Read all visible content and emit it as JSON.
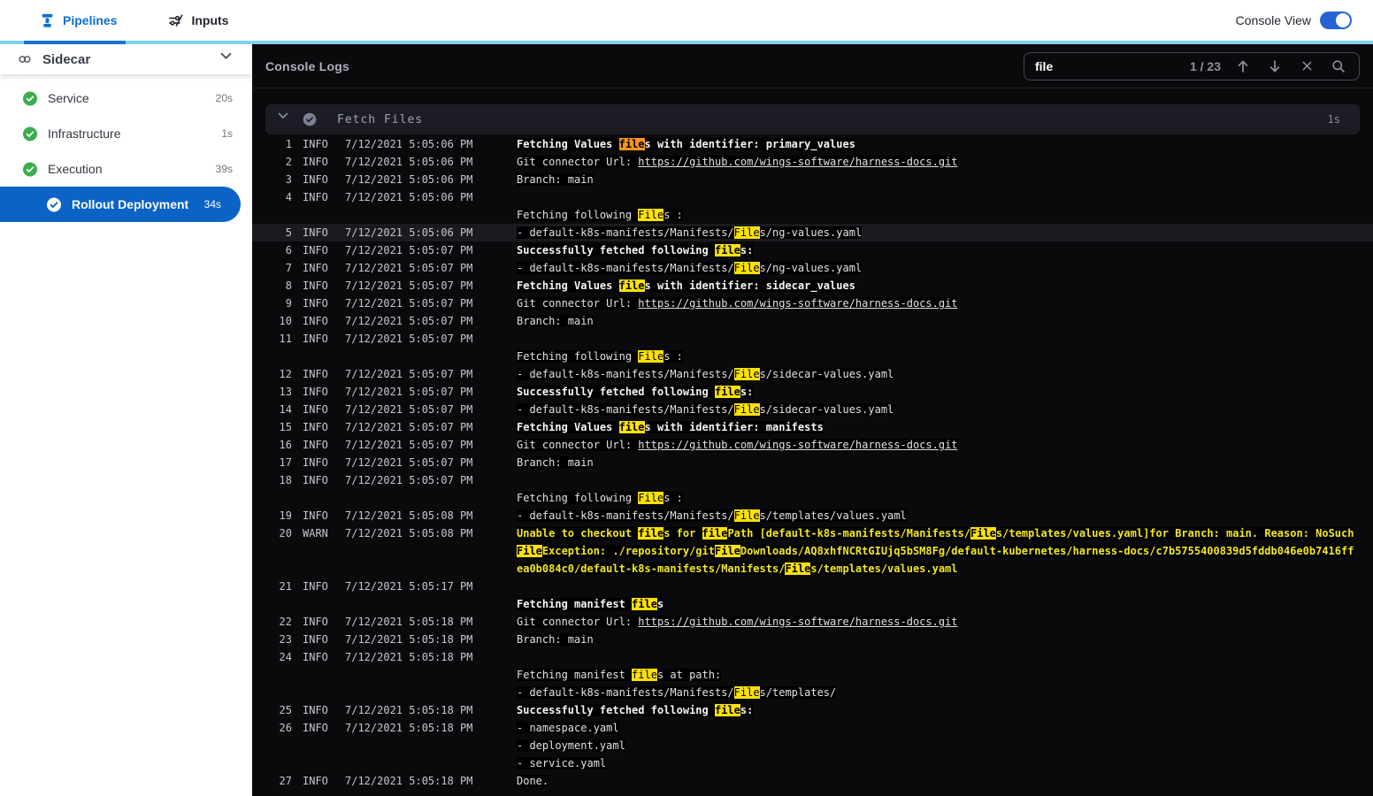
{
  "topbar": {
    "tabs": [
      {
        "label": "Pipelines"
      },
      {
        "label": "Inputs"
      }
    ],
    "active_tab": "Pipelines",
    "console_view_label": "Console View",
    "console_view_on": true
  },
  "sidebar": {
    "title": "Sidecar",
    "items": [
      {
        "label": "Service",
        "duration": "20s",
        "status": "success",
        "selected": false
      },
      {
        "label": "Infrastructure",
        "duration": "1s",
        "status": "success",
        "selected": false
      },
      {
        "label": "Execution",
        "duration": "39s",
        "status": "success",
        "selected": false
      },
      {
        "label": "Rollout Deployment",
        "duration": "34s",
        "status": "success",
        "selected": true
      }
    ]
  },
  "console": {
    "title": "Console Logs",
    "search": {
      "value": "file",
      "count_label": "1 / 23"
    },
    "section": {
      "title": "Fetch Files",
      "duration": "1s"
    }
  },
  "search_term": "file",
  "colors": {
    "accent_blue": "#0a70d3",
    "light_blue_bar": "#82d1f0",
    "selected_blue": "#0b63c5",
    "success_green": "#3bad4c",
    "match_current_bg": "#ff9321",
    "match_other_bg": "#fbe106",
    "warn_text": "#f4e81c"
  },
  "logs": [
    {
      "n": "1",
      "level": "INFO",
      "time": "7/12/2021 5:05:06 PM",
      "lines": [
        {
          "text": "Fetching Values files with identifier: primary_values",
          "bold": true
        }
      ]
    },
    {
      "n": "2",
      "level": "INFO",
      "time": "7/12/2021 5:05:06 PM",
      "lines": [
        {
          "text": "Git connector Url: ",
          "link": "https://github.com/wings-software/harness-docs.git"
        }
      ]
    },
    {
      "n": "3",
      "level": "INFO",
      "time": "7/12/2021 5:05:06 PM",
      "lines": [
        {
          "text": "Branch: main"
        }
      ]
    },
    {
      "n": "4",
      "level": "INFO",
      "time": "7/12/2021 5:05:06 PM",
      "lines": [
        {
          "text": ""
        },
        {
          "text": "Fetching following Files :"
        }
      ]
    },
    {
      "n": "5",
      "level": "INFO",
      "time": "7/12/2021 5:05:06 PM",
      "highlighted_row": true,
      "lines": [
        {
          "text": "- default-k8s-manifests/Manifests/Files/ng-values.yaml"
        }
      ]
    },
    {
      "n": "6",
      "level": "INFO",
      "time": "7/12/2021 5:05:07 PM",
      "lines": [
        {
          "text": "Successfully fetched following files:",
          "bold": true
        }
      ]
    },
    {
      "n": "7",
      "level": "INFO",
      "time": "7/12/2021 5:05:07 PM",
      "lines": [
        {
          "text": "- default-k8s-manifests/Manifests/Files/ng-values.yaml"
        }
      ]
    },
    {
      "n": "8",
      "level": "INFO",
      "time": "7/12/2021 5:05:07 PM",
      "lines": [
        {
          "text": "Fetching Values files with identifier: sidecar_values",
          "bold": true
        }
      ]
    },
    {
      "n": "9",
      "level": "INFO",
      "time": "7/12/2021 5:05:07 PM",
      "lines": [
        {
          "text": "Git connector Url: ",
          "link": "https://github.com/wings-software/harness-docs.git"
        }
      ]
    },
    {
      "n": "10",
      "level": "INFO",
      "time": "7/12/2021 5:05:07 PM",
      "lines": [
        {
          "text": "Branch: main"
        }
      ]
    },
    {
      "n": "11",
      "level": "INFO",
      "time": "7/12/2021 5:05:07 PM",
      "lines": [
        {
          "text": ""
        },
        {
          "text": "Fetching following Files :"
        }
      ]
    },
    {
      "n": "12",
      "level": "INFO",
      "time": "7/12/2021 5:05:07 PM",
      "lines": [
        {
          "text": "- default-k8s-manifests/Manifests/Files/sidecar-values.yaml"
        }
      ]
    },
    {
      "n": "13",
      "level": "INFO",
      "time": "7/12/2021 5:05:07 PM",
      "lines": [
        {
          "text": "Successfully fetched following files:",
          "bold": true
        }
      ]
    },
    {
      "n": "14",
      "level": "INFO",
      "time": "7/12/2021 5:05:07 PM",
      "lines": [
        {
          "text": "- default-k8s-manifests/Manifests/Files/sidecar-values.yaml"
        }
      ]
    },
    {
      "n": "15",
      "level": "INFO",
      "time": "7/12/2021 5:05:07 PM",
      "lines": [
        {
          "text": "Fetching Values files with identifier: manifests",
          "bold": true
        }
      ]
    },
    {
      "n": "16",
      "level": "INFO",
      "time": "7/12/2021 5:05:07 PM",
      "lines": [
        {
          "text": "Git connector Url: ",
          "link": "https://github.com/wings-software/harness-docs.git"
        }
      ]
    },
    {
      "n": "17",
      "level": "INFO",
      "time": "7/12/2021 5:05:07 PM",
      "lines": [
        {
          "text": "Branch: main"
        }
      ]
    },
    {
      "n": "18",
      "level": "INFO",
      "time": "7/12/2021 5:05:07 PM",
      "lines": [
        {
          "text": ""
        },
        {
          "text": "Fetching following Files :"
        }
      ]
    },
    {
      "n": "19",
      "level": "INFO",
      "time": "7/12/2021 5:05:08 PM",
      "lines": [
        {
          "text": "- default-k8s-manifests/Manifests/Files/templates/values.yaml"
        }
      ]
    },
    {
      "n": "20",
      "level": "WARN",
      "time": "7/12/2021 5:05:08 PM",
      "lines": [
        {
          "text": "Unable to checkout files for filePath [default-k8s-manifests/Manifests/Files/templates/values.yaml]for Branch: main. Reason: NoSuchFileException: ./repository/gitFileDownloads/AQ8xhfNCRtGIUjq5bSM8Fg/default-kubernetes/harness-docs/c7b5755400839d5fddb046e0b7416ffea0b084c0/default-k8s-manifests/Manifests/Files/templates/values.yaml",
          "bold": true
        }
      ]
    },
    {
      "n": "21",
      "level": "INFO",
      "time": "7/12/2021 5:05:17 PM",
      "lines": [
        {
          "text": ""
        },
        {
          "text": "Fetching manifest files",
          "bold": true
        }
      ]
    },
    {
      "n": "22",
      "level": "INFO",
      "time": "7/12/2021 5:05:18 PM",
      "lines": [
        {
          "text": "Git connector Url: ",
          "link": "https://github.com/wings-software/harness-docs.git"
        }
      ]
    },
    {
      "n": "23",
      "level": "INFO",
      "time": "7/12/2021 5:05:18 PM",
      "lines": [
        {
          "text": "Branch: main"
        }
      ]
    },
    {
      "n": "24",
      "level": "INFO",
      "time": "7/12/2021 5:05:18 PM",
      "lines": [
        {
          "text": ""
        },
        {
          "text": "Fetching manifest files at path:"
        },
        {
          "text": "- default-k8s-manifests/Manifests/Files/templates/"
        }
      ]
    },
    {
      "n": "25",
      "level": "INFO",
      "time": "7/12/2021 5:05:18 PM",
      "lines": [
        {
          "text": "Successfully fetched following files:",
          "bold": true
        }
      ]
    },
    {
      "n": "26",
      "level": "INFO",
      "time": "7/12/2021 5:05:18 PM",
      "lines": [
        {
          "text": "- namespace.yaml"
        },
        {
          "text": "- deployment.yaml"
        },
        {
          "text": "- service.yaml"
        }
      ]
    },
    {
      "n": "27",
      "level": "INFO",
      "time": "7/12/2021 5:05:18 PM",
      "lines": [
        {
          "text": "Done."
        }
      ]
    }
  ]
}
